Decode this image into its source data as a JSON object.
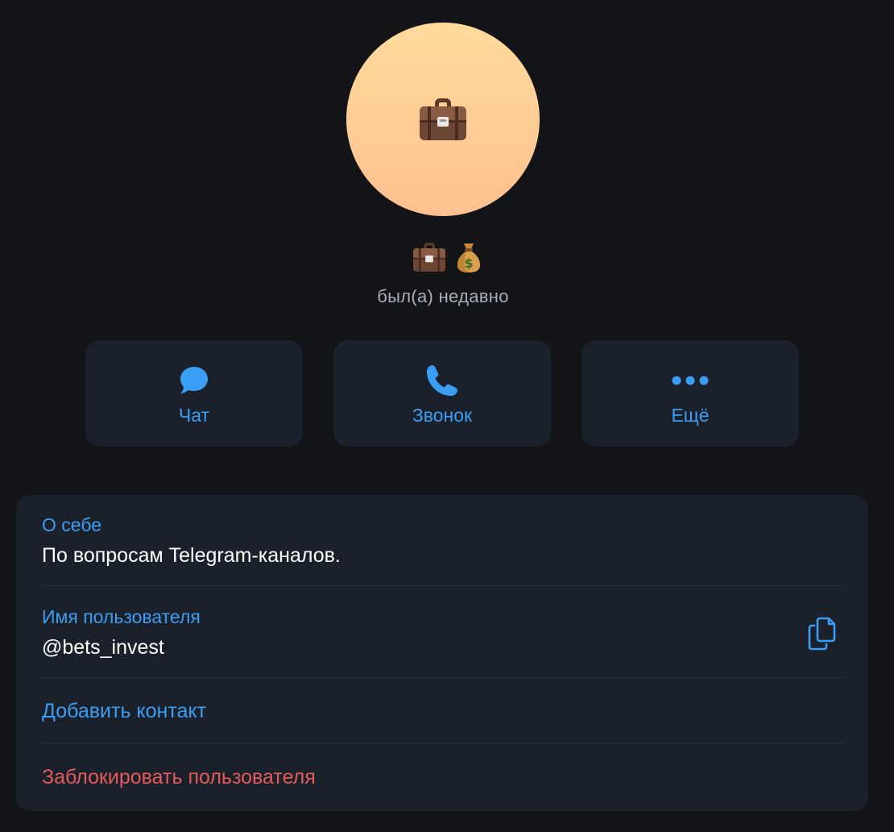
{
  "profile": {
    "avatar_emoji": "briefcase",
    "name_emojis": [
      "briefcase",
      "money-bag"
    ],
    "status": "был(а) недавно"
  },
  "actions": {
    "chat_label": "Чат",
    "call_label": "Звонок",
    "more_label": "Ещё"
  },
  "info": {
    "about_caption": "О себе",
    "about_value": "По вопросам Telegram-каналов.",
    "username_caption": "Имя пользователя",
    "username_value": "@bets_invest",
    "add_contact_label": "Добавить контакт",
    "block_label": "Заблокировать пользователя"
  },
  "colors": {
    "background": "#131417",
    "card": "#1a212b",
    "accent": "#3a9ef4",
    "danger": "#e65a5a",
    "avatar_gradient_top": "#ffdb9c",
    "avatar_gradient_bottom": "#ffc08f"
  }
}
